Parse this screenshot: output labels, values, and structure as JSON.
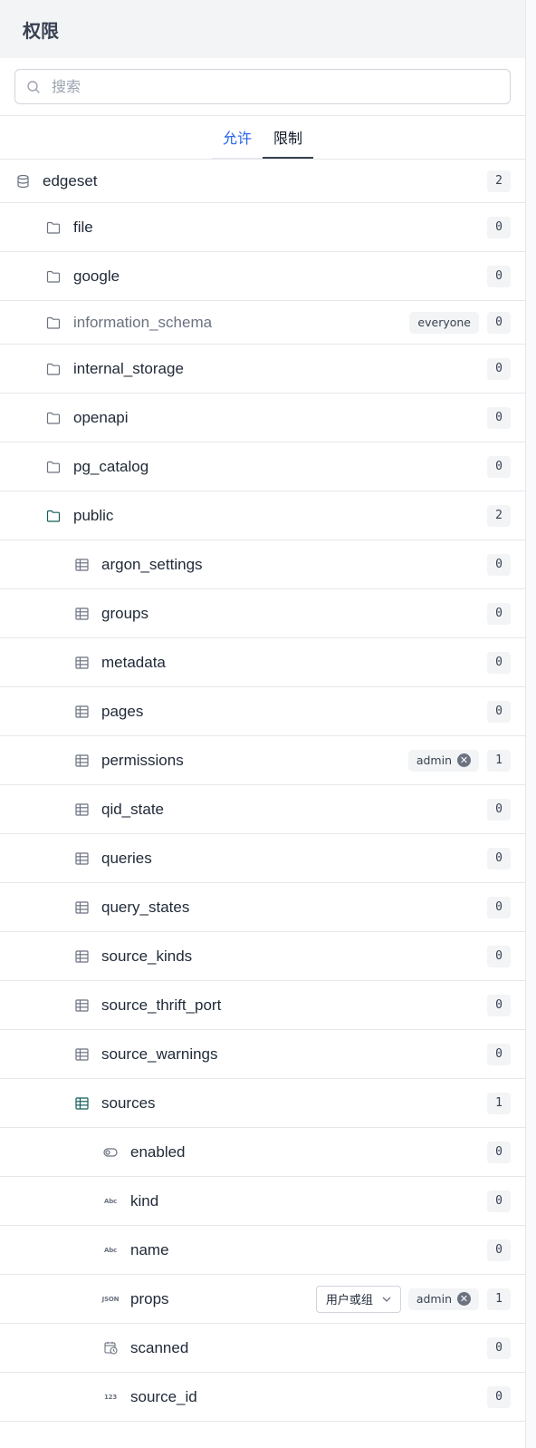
{
  "header": {
    "title": "权限"
  },
  "search": {
    "placeholder": "搜索",
    "value": ""
  },
  "tabs": [
    {
      "label": "允许"
    },
    {
      "label": "限制"
    }
  ],
  "colors": {
    "accent": "#2563eb",
    "text": "#1f2937",
    "muted": "#6b7280",
    "border": "#e5e7eb",
    "badge_bg": "#f3f4f6",
    "active_icon": "#115e59"
  },
  "tree": {
    "root": {
      "label": "edgeset",
      "count": "2",
      "icon": "database-icon"
    },
    "schemas": [
      {
        "label": "file",
        "count": "0",
        "icon": "folder-icon"
      },
      {
        "label": "google",
        "count": "0",
        "icon": "folder-icon"
      },
      {
        "label": "information_schema",
        "count": "0",
        "icon": "folder-icon",
        "chip": "everyone",
        "muted": true
      },
      {
        "label": "internal_storage",
        "count": "0",
        "icon": "folder-icon"
      },
      {
        "label": "openapi",
        "count": "0",
        "icon": "folder-icon"
      },
      {
        "label": "pg_catalog",
        "count": "0",
        "icon": "folder-icon"
      },
      {
        "label": "public",
        "count": "2",
        "icon": "folder-icon",
        "active": true
      }
    ],
    "tables": [
      {
        "label": "argon_settings",
        "count": "0"
      },
      {
        "label": "groups",
        "count": "0"
      },
      {
        "label": "metadata",
        "count": "0"
      },
      {
        "label": "pages",
        "count": "0"
      },
      {
        "label": "permissions",
        "count": "1",
        "chip": "admin"
      },
      {
        "label": "qid_state",
        "count": "0"
      },
      {
        "label": "queries",
        "count": "0"
      },
      {
        "label": "query_states",
        "count": "0"
      },
      {
        "label": "source_kinds",
        "count": "0"
      },
      {
        "label": "source_thrift_port",
        "count": "0"
      },
      {
        "label": "source_warnings",
        "count": "0"
      },
      {
        "label": "sources",
        "count": "1",
        "active": true
      }
    ],
    "columns": [
      {
        "label": "enabled",
        "count": "0",
        "icon": "toggle-icon"
      },
      {
        "label": "kind",
        "count": "0",
        "icon": "abc-icon",
        "icon_text": "Abc"
      },
      {
        "label": "name",
        "count": "0",
        "icon": "abc-icon",
        "icon_text": "Abc"
      },
      {
        "label": "props",
        "count": "1",
        "icon": "json-icon",
        "icon_text": "JSON",
        "dropdown": "用户或组",
        "chip": "admin"
      },
      {
        "label": "scanned",
        "count": "0",
        "icon": "calendar-clock-icon"
      },
      {
        "label": "source_id",
        "count": "0",
        "icon": "number-icon",
        "icon_text": "123"
      }
    ]
  }
}
